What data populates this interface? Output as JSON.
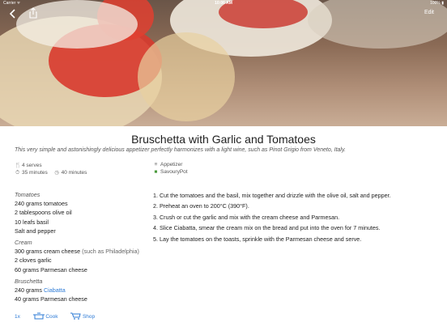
{
  "status_bar": {
    "carrier": "Carrier ᯤ",
    "time": "10:06 AM",
    "battery": "100% ▮"
  },
  "nav": {
    "edit_label": "Edit",
    "back_icon": "chevron-left-icon",
    "share_icon": "share-icon"
  },
  "recipe": {
    "title": "Bruschetta with Garlic and Tomatoes",
    "description": "This very simple and astonishingly delicious appetizer perfectly harmonizes with a light wine, such as Pinot Grigio from Veneto, Italy.",
    "serves": "4 serves",
    "prep_time": "35 minutes",
    "total_time": "40 minutes",
    "category": "Appetizer",
    "source": "SavouryPot"
  },
  "ingredients": {
    "groups": [
      {
        "name": "Tomatoes",
        "items": [
          {
            "qty": "240 grams",
            "name": "tomatoes",
            "note": ""
          },
          {
            "qty": "2 tablespoons",
            "name": "olive oil",
            "note": ""
          },
          {
            "qty": "10 leafs",
            "name": "basil",
            "note": ""
          },
          {
            "qty": "",
            "name": "Salt and pepper",
            "note": ""
          }
        ]
      },
      {
        "name": "Cream",
        "items": [
          {
            "qty": "300 grams",
            "name": "cream cheese",
            "note": "(such as Philadelphia)"
          },
          {
            "qty": "2 cloves",
            "name": "garlic",
            "note": ""
          },
          {
            "qty": "60 grams",
            "name": "Parmesan cheese",
            "note": ""
          }
        ]
      },
      {
        "name": "Bruschetta",
        "items": [
          {
            "qty": "240 grams",
            "name": "Ciabatta",
            "note": "",
            "link": true
          },
          {
            "qty": "40 grams",
            "name": "Parmesan cheese",
            "note": ""
          }
        ]
      }
    ]
  },
  "steps": [
    "1. Cut the tomatoes and the basil, mix together and drizzle with the olive oil, salt and pepper.",
    "2. Preheat an oven to 200°C (390°F).",
    "3. Crush or cut the garlic and mix with the cream cheese and Parmesan.",
    "4. Slice Ciabatta, smear the cream mix on the bread and put into the oven for 7 minutes.",
    "5. Lay the tomatoes on the toasts, sprinkle with the Parmesan cheese and serve."
  ],
  "bottom_bar": {
    "scale": "1x",
    "cook_label": "Cook",
    "shop_label": "Shop"
  },
  "colors": {
    "accent": "#2e7bd6",
    "category_green": "#4a9a3c"
  }
}
